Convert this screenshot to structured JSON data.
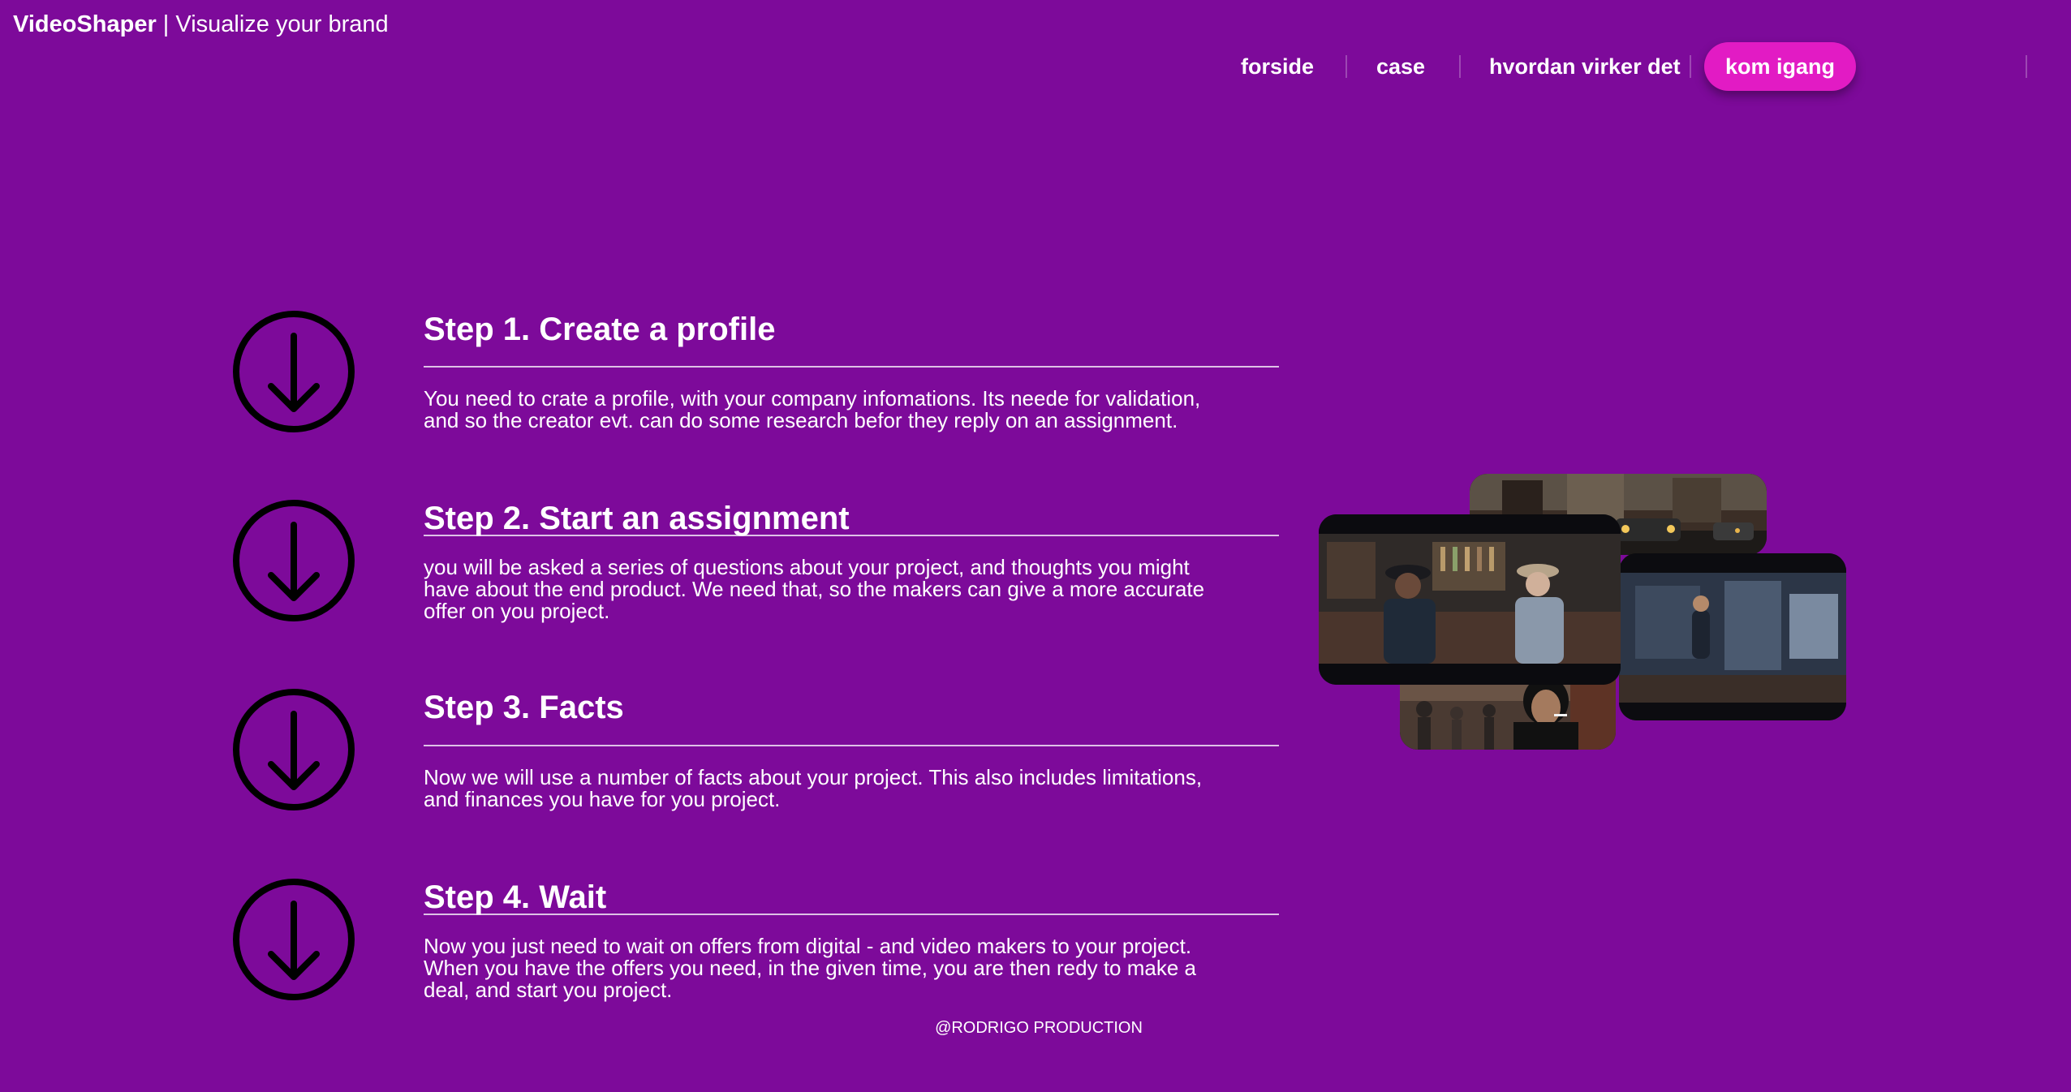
{
  "header": {
    "brand_name": "VideoShaper",
    "brand_separator": " | ",
    "brand_tagline": "Visualize your brand"
  },
  "nav": {
    "items": [
      {
        "label": "forside"
      },
      {
        "label": "case"
      },
      {
        "label": "hvordan virker det"
      }
    ],
    "cta_label": "kom igang"
  },
  "steps": [
    {
      "title": "Step 1. Create a profile",
      "lines": [
        "You need to crate a profile, with your company infomations. Its neede for validation,",
        "and so the creator evt. can do some research befor they reply on an assignment."
      ]
    },
    {
      "title": "Step 2. Start an assignment",
      "lines": [
        "you will be asked a series of questions about your project, and thoughts you might",
        "have about the end product. We need that, so the makers can give a more accurate",
        "offer on you project."
      ]
    },
    {
      "title": "Step 3. Facts",
      "lines": [
        "Now we will use a number of facts about your project. This also includes limitations,",
        "and finances you have for you project."
      ]
    },
    {
      "title": "Step 4. Wait",
      "lines": [
        "Now you just need to wait on offers from digital - and video makers to your project.",
        "When you have the offers you need, in the given time, you are then redy to make a",
        "deal, and start you project."
      ]
    }
  ],
  "icons": {
    "step_icon": "arrow-down-circle-icon"
  },
  "colors": {
    "background": "#7d0a9a",
    "cta": "#e21bc4",
    "icon_stroke": "#000000",
    "text": "#ffffff"
  },
  "footer": {
    "text": "@RODRIGO PRODUCTION"
  }
}
